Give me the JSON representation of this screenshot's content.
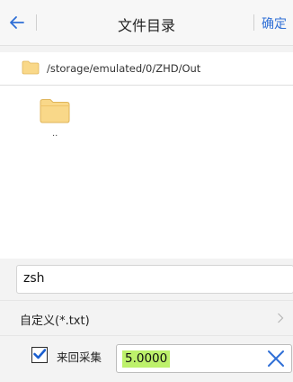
{
  "header": {
    "title": "文件目录",
    "confirm_label": "确定"
  },
  "pathbar": {
    "path": "/storage/emulated/0/ZHD/Out"
  },
  "files": [
    {
      "name": ".."
    }
  ],
  "filename_input": {
    "value": "zsh"
  },
  "filter": {
    "label": "自定义(*.txt)"
  },
  "bottom": {
    "checkbox_label": "来回采集",
    "checkbox_checked": true,
    "distance_value": "5.0000"
  },
  "colors": {
    "accent_blue": "#2f6fd6",
    "folder_yellow": "#f5cd6e",
    "selection_green": "#bdf16b"
  }
}
